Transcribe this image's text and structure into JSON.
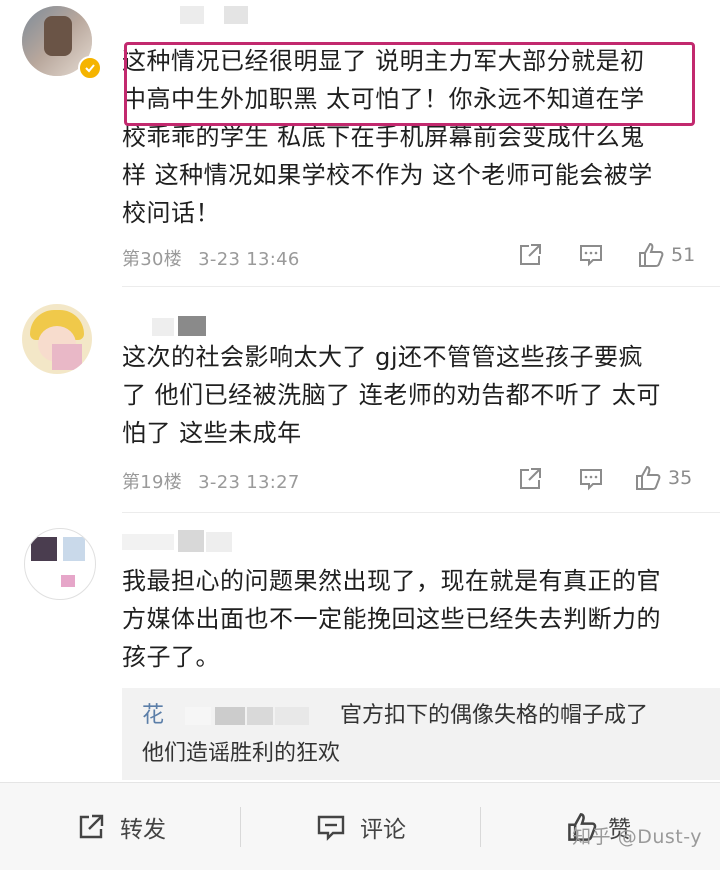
{
  "comments": [
    {
      "lines": [
        "这种情况已经很明显了 说明主力军大部分就是初",
        "中高中生外加职黑 太可怕了！你永远不知道在学",
        "校乖乖的学生 私底下在手机屏幕前会变成什么鬼",
        "样 这种情况如果学校不作为 这个老师可能会被学",
        "校问话！"
      ],
      "floor": "第30楼",
      "time": "3-23 13:46",
      "likes": "51"
    },
    {
      "lines": [
        "这次的社会影响太大了 gj还不管管这些孩子要疯",
        "了 他们已经被洗脑了 连老师的劝告都不听了 太可",
        "怕了 这些未成年"
      ],
      "floor": "第19楼",
      "time": "3-23 13:27",
      "likes": "35"
    },
    {
      "lines": [
        "我最担心的问题果然出现了，现在就是有真正的官",
        "方媒体出面也不一定能挽回这些已经失去判断力的",
        "孩子了。"
      ],
      "reply": {
        "name_prefix": "花",
        "line1": "官方扣下的偶像失格的帽子成了",
        "line2": "他们造谣胜利的狂欢"
      }
    }
  ],
  "bottom_bar": {
    "repost": "转发",
    "comment": "评论",
    "like": "赞"
  },
  "watermark": "知乎 @Dust-y",
  "colors": {
    "highlight": "#c2296e",
    "verified_badge": "#f5b400"
  }
}
